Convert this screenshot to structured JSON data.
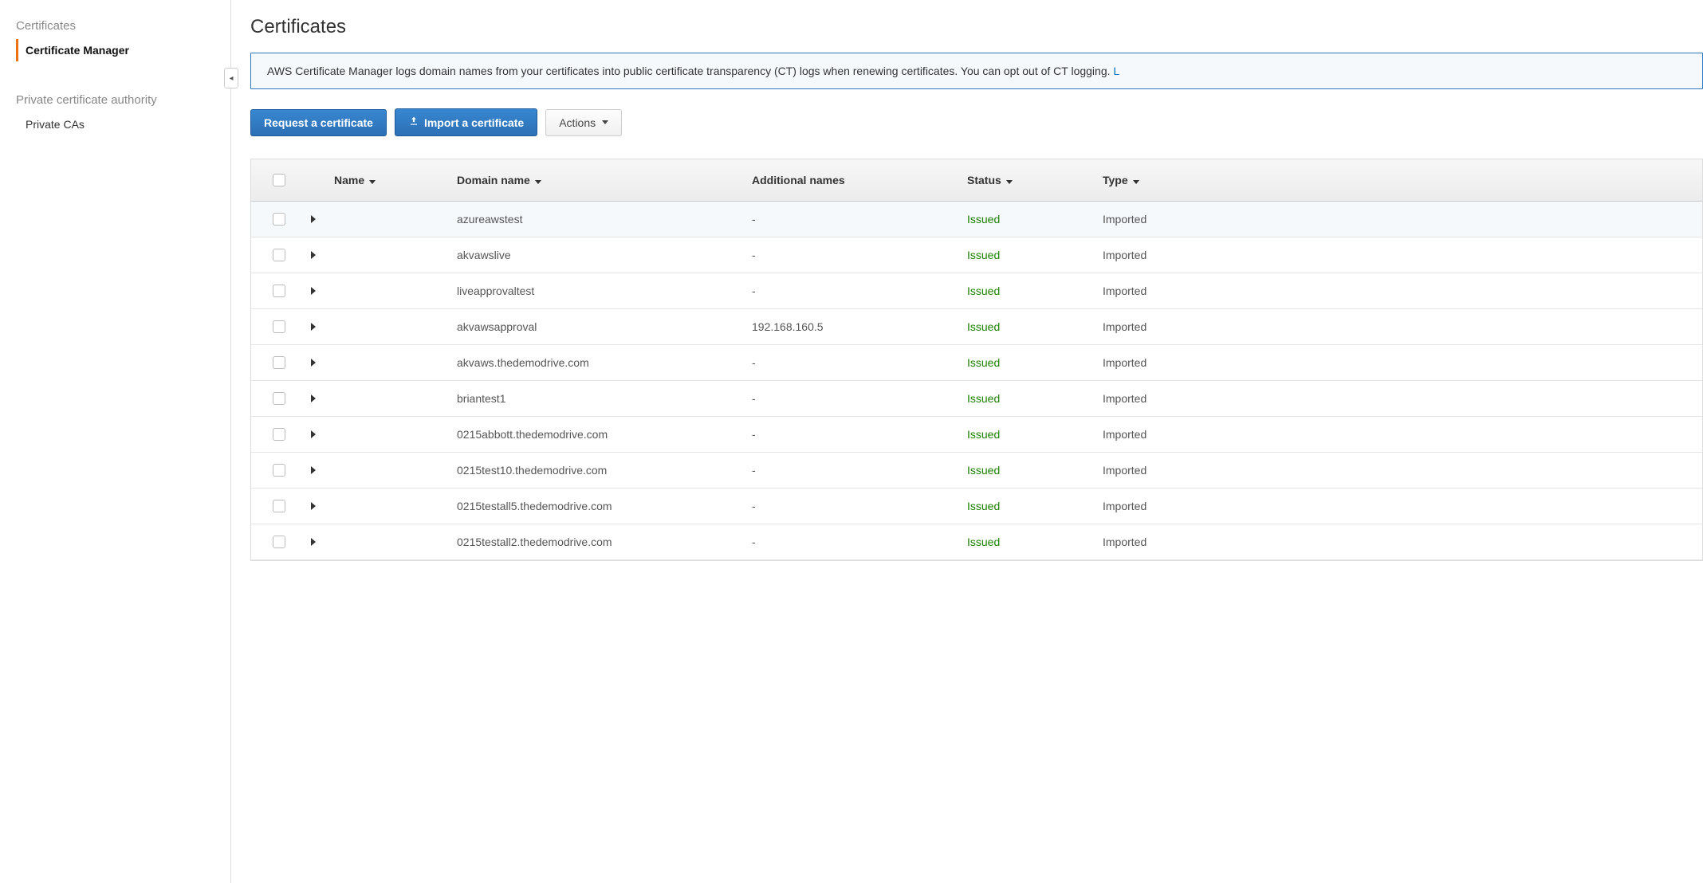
{
  "sidebar": {
    "sections": [
      {
        "header": "Certificates",
        "items": [
          {
            "label": "Certificate Manager",
            "active": true
          }
        ]
      },
      {
        "header": "Private certificate authority",
        "items": [
          {
            "label": "Private CAs",
            "active": false
          }
        ]
      }
    ]
  },
  "page": {
    "title": "Certificates"
  },
  "banner": {
    "text": "AWS Certificate Manager logs domain names from your certificates into public certificate transparency (CT) logs when renewing certificates. You can opt out of CT logging. ",
    "link": "L"
  },
  "buttons": {
    "request": "Request a certificate",
    "import": "Import a certificate",
    "actions": "Actions"
  },
  "table": {
    "headers": {
      "name": "Name",
      "domain": "Domain name",
      "additional": "Additional names",
      "status": "Status",
      "type": "Type"
    },
    "rows": [
      {
        "name": "",
        "domain": "azureawstest",
        "additional": "-",
        "status": "Issued",
        "type": "Imported",
        "hover": true
      },
      {
        "name": "",
        "domain": "akvawslive",
        "additional": "-",
        "status": "Issued",
        "type": "Imported"
      },
      {
        "name": "",
        "domain": "liveapprovaltest",
        "additional": "-",
        "status": "Issued",
        "type": "Imported"
      },
      {
        "name": "",
        "domain": "akvawsapproval",
        "additional": "192.168.160.5",
        "status": "Issued",
        "type": "Imported"
      },
      {
        "name": "",
        "domain": "akvaws.thedemodrive.com",
        "additional": "-",
        "status": "Issued",
        "type": "Imported"
      },
      {
        "name": "",
        "domain": "briantest1",
        "additional": "-",
        "status": "Issued",
        "type": "Imported"
      },
      {
        "name": "",
        "domain": "0215abbott.thedemodrive.com",
        "additional": "-",
        "status": "Issued",
        "type": "Imported"
      },
      {
        "name": "",
        "domain": "0215test10.thedemodrive.com",
        "additional": "-",
        "status": "Issued",
        "type": "Imported"
      },
      {
        "name": "",
        "domain": "0215testall5.thedemodrive.com",
        "additional": "-",
        "status": "Issued",
        "type": "Imported"
      },
      {
        "name": "",
        "domain": "0215testall2.thedemodrive.com",
        "additional": "-",
        "status": "Issued",
        "type": "Imported"
      }
    ]
  }
}
